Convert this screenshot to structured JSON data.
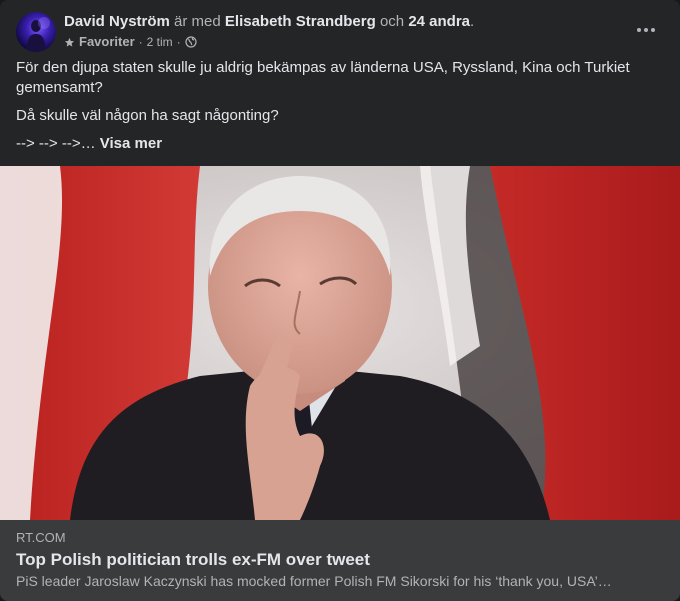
{
  "post": {
    "author": "David Nyström",
    "with_text": "är med",
    "tagged": "Elisabeth Strandberg",
    "and_text": "och",
    "others": "24 andra",
    "period": ".",
    "favorites_label": "Favoriter",
    "time": "2 tim",
    "dot": "·",
    "paragraph1": "För den djupa staten skulle ju aldrig bekämpas av länderna USA, Ryssland, Kina och Turkiet gemensamt?",
    "paragraph2": "Då skulle väl någon ha sagt någonting?",
    "paragraph3_prefix": "--> --> -->…",
    "see_more": "Visa mer"
  },
  "link": {
    "domain": "RT.COM",
    "title": "Top Polish politician trolls ex-FM over tweet",
    "description": "PiS leader Jaroslaw Kaczynski has mocked former Polish FM Sikorski for his ‘thank you, USA’…"
  },
  "icons": {
    "options": "more-options-icon",
    "favorite": "star-icon",
    "privacy": "globe-icon"
  },
  "colors": {
    "background": "#242526",
    "link_box": "#3a3b3c",
    "text_primary": "#e4e6eb",
    "text_secondary": "#b0b3b8"
  }
}
